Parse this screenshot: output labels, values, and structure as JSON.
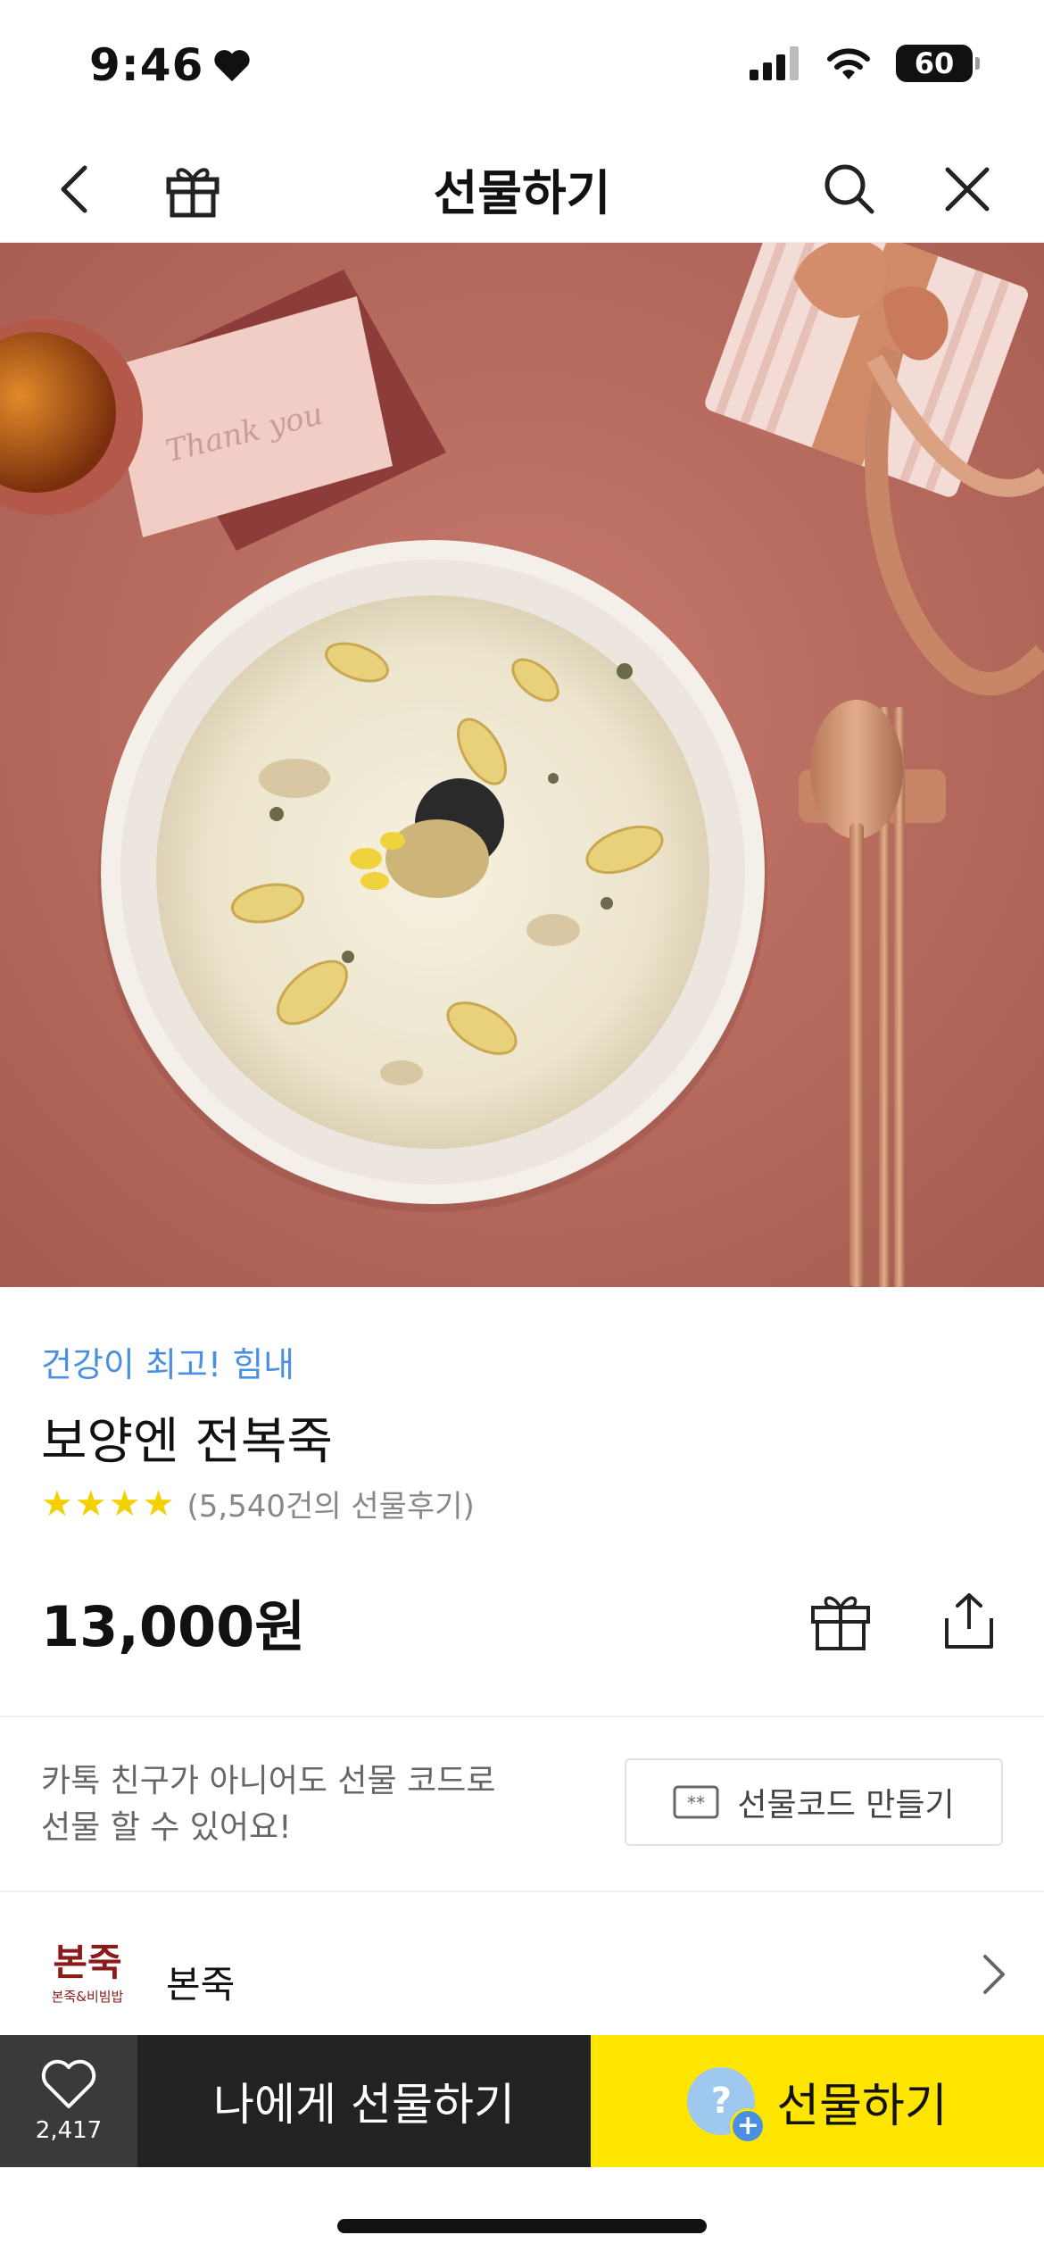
{
  "status_bar": {
    "time": "9:46",
    "battery": "60"
  },
  "nav": {
    "title": "선물하기",
    "back_icon": "chevron-left-icon",
    "gift_icon": "gift-icon",
    "search_icon": "search-icon",
    "close_icon": "close-icon"
  },
  "hero": {
    "image": "abalone-porridge-photo"
  },
  "product": {
    "tagline": "건강이 최고! 힘내",
    "name": "보양엔 전복죽",
    "rating_count": "(5,540건의 선물후기)",
    "price": "13,000원"
  },
  "gift_code": {
    "text_line1": "카톡 친구가 아니어도 선물 코드로",
    "text_line2": "선물 할 수 있어요!",
    "button_label": "선물코드 만들기"
  },
  "brand": {
    "logo_text": "본죽",
    "logo_sub": "본죽&비빔밥",
    "name": "본죽"
  },
  "bottom_bar": {
    "like_count": "2,417",
    "self_gift_label": "나에게 선물하기",
    "gift_label": "선물하기",
    "gift_badge_text": "?"
  },
  "colors": {
    "accent_yellow": "#fee500",
    "tagline_blue": "#4a90e2",
    "dark": "#222222"
  }
}
